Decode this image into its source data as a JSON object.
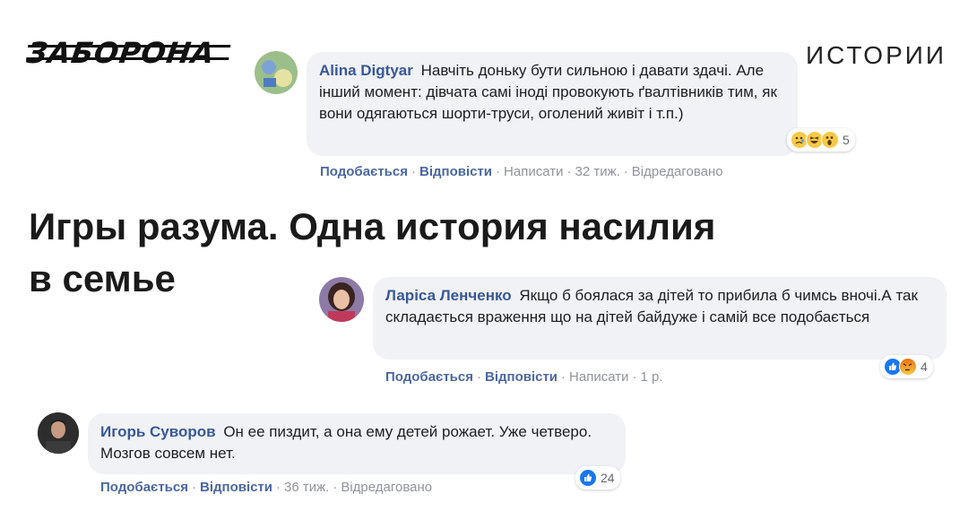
{
  "header": {
    "logo_text": "ЗАБОРОНА",
    "section": "ИСТОРИИ"
  },
  "article": {
    "title_line1": "Игры разума. Одна история насилия",
    "title_line2": "в семье"
  },
  "comments": [
    {
      "author": "Alina Digtyar",
      "text": "Навчіть доньку бути сильною і давати здачі. Але інший момент: дівчата самі іноді провокують ґвалтівників тим, як вони одягаються шорти-труси, оголений живіт і т.п.)",
      "reactions": [
        "sad-icon",
        "laugh-icon",
        "wow-icon"
      ],
      "reaction_count": "5",
      "like": "Подобається",
      "reply": "Відповісти",
      "write": "Написати",
      "time": "32 тиж.",
      "edited": "Відредаговано"
    },
    {
      "author": "Ларіса Ленченко",
      "text": "Якщо б боялася за дітей то прибила б чимсь вночі.А так складається враження що на дітей байдуже і самій все подобається",
      "reactions": [
        "like-icon",
        "angry-icon"
      ],
      "reaction_count": "4",
      "like": "Подобається",
      "reply": "Відповісти",
      "write": "Написати",
      "time": "1 р."
    },
    {
      "author": "Игорь Суворов",
      "text": "Он ее пиздит, а она ему детей рожает. Уже четверо. Мозгов совсем нет.",
      "reactions": [
        "like-icon"
      ],
      "reaction_count": "24",
      "like": "Подобається",
      "reply": "Відповісти",
      "time": "36 тиж.",
      "edited": "Відредаговано"
    }
  ],
  "colors": {
    "author_link": "#385898",
    "action_link": "#4b67a1",
    "bubble_bg": "#f0f2f5",
    "like_blue": "#1877f2",
    "emoji_yellow": "#f7c948"
  }
}
